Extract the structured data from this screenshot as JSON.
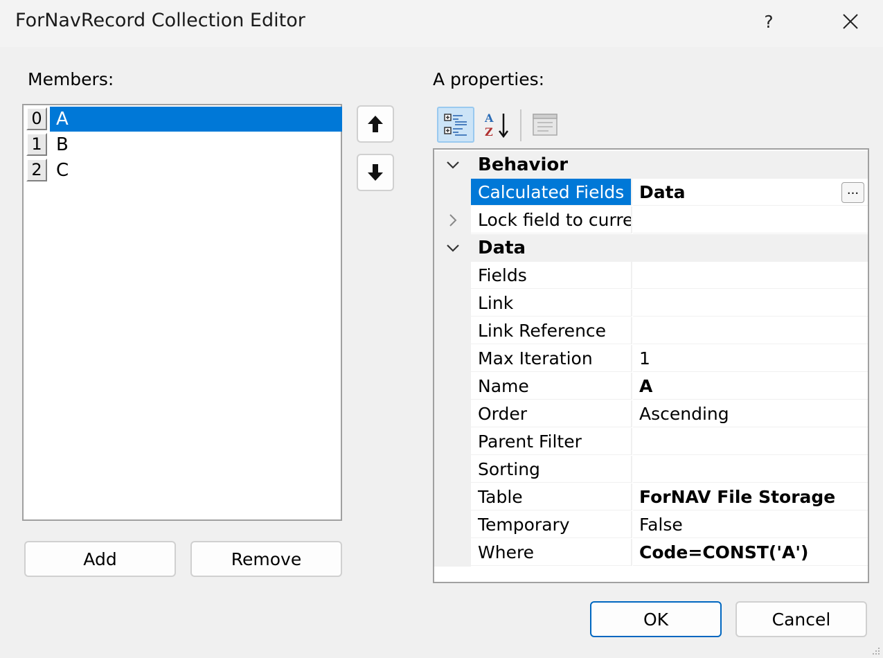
{
  "window": {
    "title": "ForNavRecord Collection Editor",
    "help_glyph": "?"
  },
  "members": {
    "label": "Members:",
    "items": [
      {
        "index": "0",
        "name": "A",
        "selected": true
      },
      {
        "index": "1",
        "name": "B",
        "selected": false
      },
      {
        "index": "2",
        "name": "C",
        "selected": false
      }
    ],
    "add_label": "Add",
    "remove_label": "Remove"
  },
  "properties": {
    "label": "A properties:",
    "rows": [
      {
        "kind": "category",
        "name": "Behavior",
        "expanded": true
      },
      {
        "kind": "prop",
        "name": "Calculated Fields",
        "value": "Data",
        "bold": true,
        "selected": true,
        "ellipsis": "..."
      },
      {
        "kind": "prop",
        "name": "Lock field to currer",
        "value": "",
        "expandable": true
      },
      {
        "kind": "category",
        "name": "Data",
        "expanded": true
      },
      {
        "kind": "prop",
        "name": "Fields",
        "value": ""
      },
      {
        "kind": "prop",
        "name": "Link",
        "value": ""
      },
      {
        "kind": "prop",
        "name": "Link Reference",
        "value": ""
      },
      {
        "kind": "prop",
        "name": "Max Iteration",
        "value": "1"
      },
      {
        "kind": "prop",
        "name": "Name",
        "value": "A",
        "bold": true
      },
      {
        "kind": "prop",
        "name": "Order",
        "value": "Ascending"
      },
      {
        "kind": "prop",
        "name": "Parent Filter",
        "value": ""
      },
      {
        "kind": "prop",
        "name": "Sorting",
        "value": ""
      },
      {
        "kind": "prop",
        "name": "Table",
        "value": "ForNAV File Storage",
        "bold": true
      },
      {
        "kind": "prop",
        "name": "Temporary",
        "value": "False"
      },
      {
        "kind": "prop",
        "name": "Where",
        "value": "Code=CONST('A')",
        "bold": true
      }
    ]
  },
  "footer": {
    "ok_label": "OK",
    "cancel_label": "Cancel"
  },
  "colors": {
    "selection": "#0078d7",
    "accent": "#0067c0"
  }
}
